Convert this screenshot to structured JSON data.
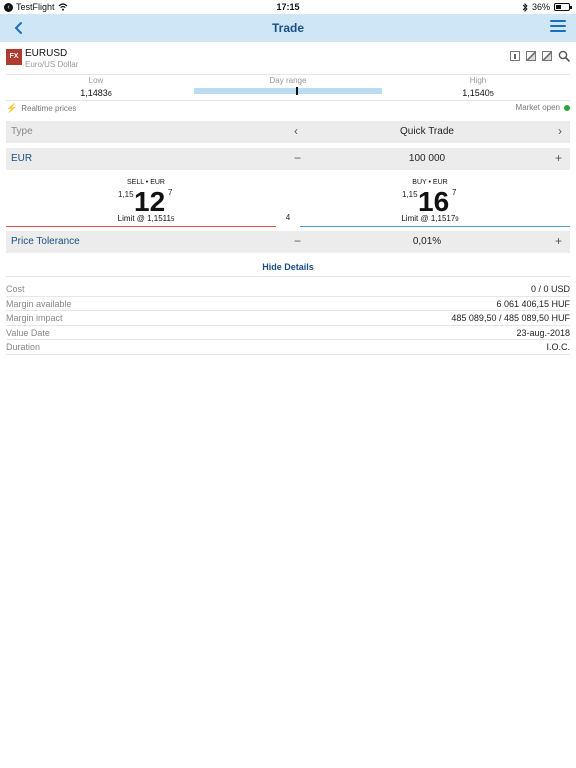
{
  "status_bar": {
    "back_app": "TestFlight",
    "time": "17:15",
    "battery": "36%",
    "battery_level": 0.36
  },
  "nav": {
    "title": "Trade"
  },
  "instrument": {
    "badge": "FX",
    "symbol": "EURUSD",
    "description": "Euro/US Dollar"
  },
  "day_range": {
    "low_label": "Low",
    "low_value": "1,1483",
    "low_pip": "6",
    "range_label": "Day range",
    "high_label": "High",
    "high_value": "1,1540",
    "high_pip": "5",
    "current_position": 0.55
  },
  "prices": {
    "realtime_label": "Realtime prices",
    "market_status": "Market open"
  },
  "order": {
    "type_label": "Type",
    "type_value": "Quick Trade",
    "currency_label": "EUR",
    "amount_value": "100 000",
    "minus": "−",
    "plus": "+"
  },
  "sell": {
    "header": "SELL • EUR",
    "prefix": "1,15",
    "big": "12",
    "sup": "7",
    "limit": "Limit @ 1,1511",
    "limit_pip": "5"
  },
  "buy": {
    "header": "BUY • EUR",
    "prefix": "1,15",
    "big": "16",
    "sup": "7",
    "limit": "Limit @ 1,1517",
    "limit_pip": "9"
  },
  "spread": "4",
  "tolerance": {
    "label": "Price Tolerance",
    "value": "0,01%"
  },
  "hide_details": "Hide Details",
  "details": [
    {
      "label": "Cost",
      "value": "0 / 0 USD"
    },
    {
      "label": "Margin available",
      "value": "6 061 406,15 HUF"
    },
    {
      "label": "Margin impact",
      "value": "485 089,50 / 485 089,50 HUF"
    },
    {
      "label": "Value Date",
      "value": "23-aug.-2018"
    },
    {
      "label": "Duration",
      "value": "I.O.C."
    }
  ],
  "colors": {
    "nav_bg": "#cfe6f6",
    "nav_title": "#1a4f83",
    "sell_border": "#d9534f",
    "buy_border": "#4a9fd8",
    "fx_badge": "#b03a2e",
    "market_open": "#2aa53a"
  },
  "icons": {
    "back": "chevron-left-icon",
    "menu": "hamburger-menu-icon",
    "info": "info-icon",
    "chart1": "chart-icon",
    "chart2": "chart-icon",
    "search": "search-icon",
    "realtime": "lightning-icon"
  }
}
